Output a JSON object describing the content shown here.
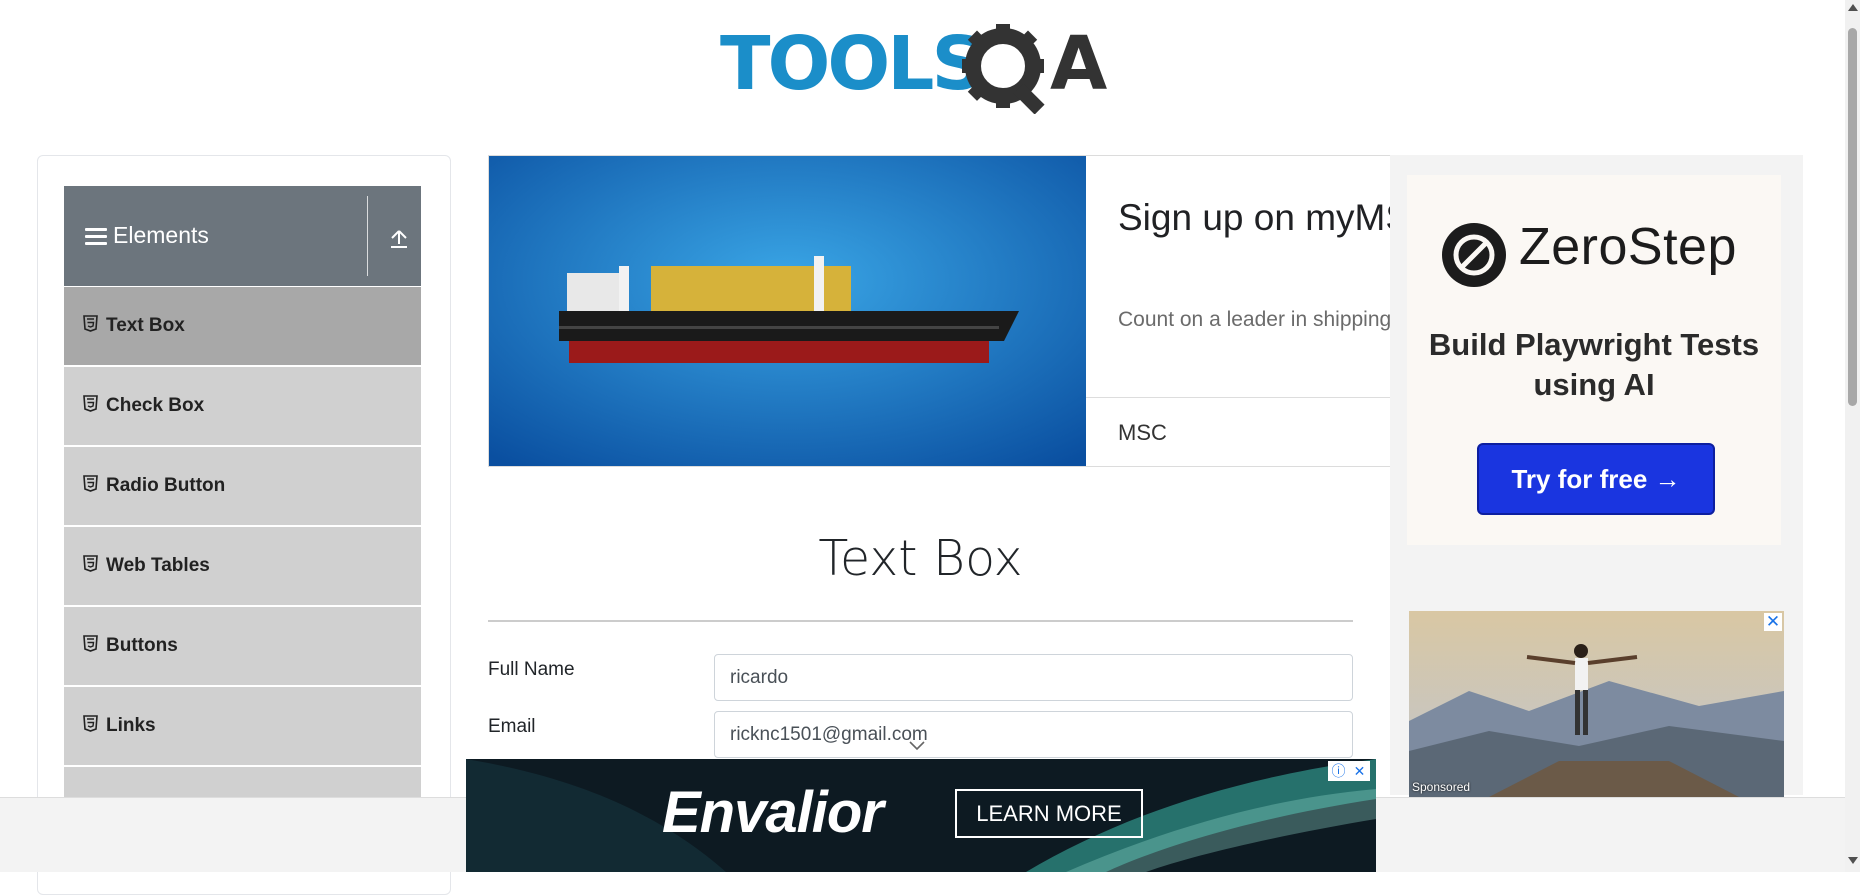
{
  "logo": {
    "text_tools": "TOOLS",
    "text_qa": "QA"
  },
  "sidebar": {
    "group_title": "Elements",
    "items": [
      {
        "label": "Text Box",
        "active": true
      },
      {
        "label": "Check Box"
      },
      {
        "label": "Radio Button"
      },
      {
        "label": "Web Tables"
      },
      {
        "label": "Buttons"
      },
      {
        "label": "Links"
      }
    ]
  },
  "ad_banner": {
    "title": "Sign up on myMSC Online",
    "description": "Count on a leader in shipping as a partner for all businesses",
    "brand": "MSC"
  },
  "right_ad": {
    "brand": "ZeroStep",
    "tagline": "Build Playwright Tests using AI",
    "cta": "Try for free →",
    "sponsored_label": "Sponsored",
    "close_glyph": "✕"
  },
  "main": {
    "title": "Text Box",
    "fields": [
      {
        "label": "Full Name",
        "value": "ricardo"
      },
      {
        "label": "Email",
        "value": "ricknc1501@gmail.com"
      }
    ]
  },
  "bottom_ad": {
    "brand": "Envalior",
    "cta": "LEARN MORE",
    "info_glyph": "ⓘ",
    "close_glyph": "✕"
  },
  "colors": {
    "accent": "#1a35e0",
    "sidebar_header": "#6c757d",
    "sidebar_item": "#d0d0d0",
    "sidebar_active": "#a8a8a8"
  }
}
